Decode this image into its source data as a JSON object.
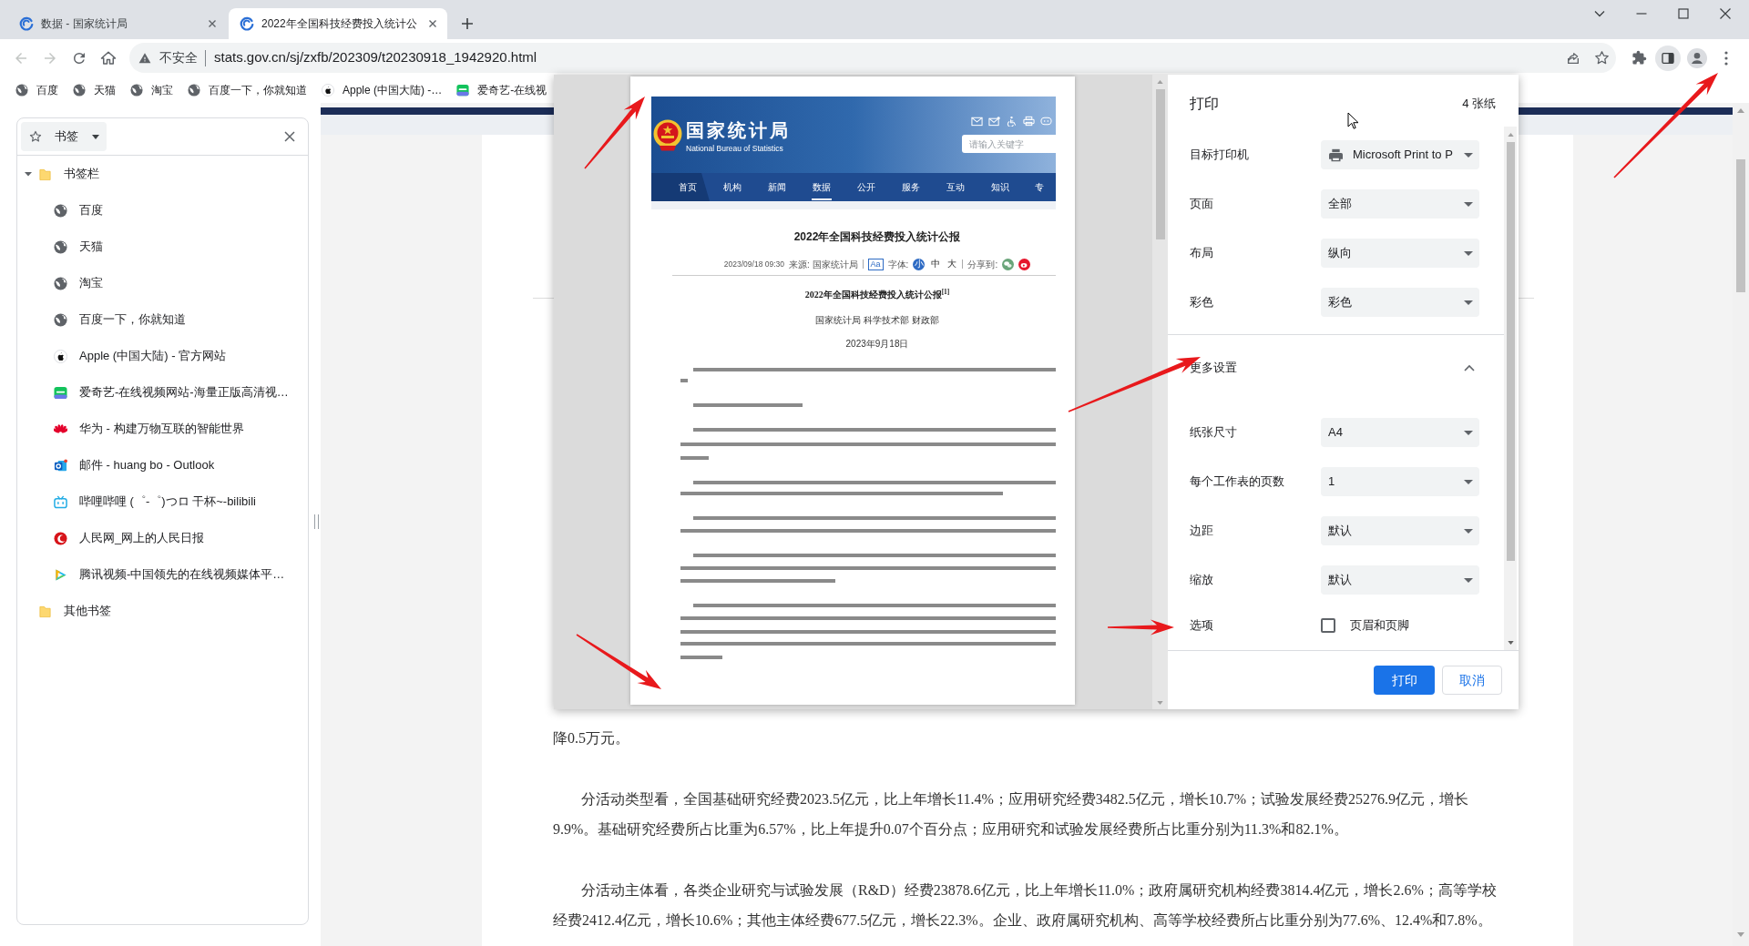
{
  "tabs": [
    {
      "title": "数据 - 国家统计局",
      "selected": false
    },
    {
      "title": "2022年全国科技经费投入统计公",
      "selected": true
    }
  ],
  "navigation_buttons": [
    {
      "kind": "back",
      "disabled": true
    },
    {
      "kind": "forward",
      "disabled": true
    },
    {
      "kind": "reload",
      "disabled": false
    },
    {
      "kind": "home",
      "disabled": false
    }
  ],
  "address_bar": {
    "security_label": "不安全",
    "url": "stats.gov.cn/sj/zxfb/202309/t20230918_1942920.html"
  },
  "bookmarks_bar": [
    {
      "label": "百度",
      "kind": "globe"
    },
    {
      "label": "天猫",
      "kind": "globe"
    },
    {
      "label": "淘宝",
      "kind": "globe"
    },
    {
      "label": "百度一下，你就知道",
      "kind": "globe"
    },
    {
      "label": "Apple (中国大陆) -…",
      "kind": "apple"
    },
    {
      "label": "爱奇艺-在线视",
      "kind": "iqiyi"
    }
  ],
  "side_panel": {
    "open": true,
    "title": "书签",
    "tree": [
      {
        "label": "书签栏",
        "kind": "folder",
        "expanded": true,
        "children": [
          {
            "label": "百度",
            "kind": "globe"
          },
          {
            "label": "天猫",
            "kind": "globe"
          },
          {
            "label": "淘宝",
            "kind": "globe"
          },
          {
            "label": "百度一下，你就知道",
            "kind": "globe"
          },
          {
            "label": "Apple (中国大陆) - 官方网站",
            "kind": "apple"
          },
          {
            "label": "爱奇艺-在线视频网站-海量正版高清视…",
            "kind": "iqiyi"
          },
          {
            "label": "华为 - 构建万物互联的智能世界",
            "kind": "huawei"
          },
          {
            "label": "邮件 - huang bo - Outlook",
            "kind": "outlook"
          },
          {
            "label": "哔哩哔哩 (゜-゜)つロ 干杯~-bilibili",
            "kind": "bilibili"
          },
          {
            "label": "人民网_网上的人民日报",
            "kind": "renmin"
          },
          {
            "label": "腾讯视频-中国领先的在线视频媒体平…",
            "kind": "tencent"
          }
        ]
      },
      {
        "label": "其他书签",
        "kind": "folder"
      }
    ]
  },
  "print_dialog": {
    "title": "打印",
    "sheet_count": "4 张纸",
    "preview": {
      "site_title": "国家统计局",
      "site_subtitle": "National Bureau of Statistics",
      "search_placeholder": "请输入关键字",
      "nav": [
        {
          "label": "首页",
          "kind": "home",
          "selected": false
        },
        {
          "label": "机构",
          "kind": "link",
          "selected": false
        },
        {
          "label": "新闻",
          "kind": "link",
          "selected": false
        },
        {
          "label": "数据",
          "kind": "link",
          "selected": true
        },
        {
          "label": "公开",
          "kind": "link",
          "selected": false
        },
        {
          "label": "服务",
          "kind": "link",
          "selected": false
        },
        {
          "label": "互动",
          "kind": "link",
          "selected": false
        },
        {
          "label": "知识",
          "kind": "link",
          "selected": false
        },
        {
          "label": "专",
          "kind": "link",
          "selected": false
        }
      ],
      "article_title": "2022年全国科技经费投入统计公报",
      "meta": {
        "datetime": "2023/09/18 09:30",
        "source": "来源: 国家统计局",
        "font_button": "Aa",
        "font_label": "字体:",
        "font_sizes": [
          {
            "label": "小",
            "selected": true
          },
          {
            "label": "中",
            "selected": false
          },
          {
            "label": "大",
            "selected": false
          }
        ],
        "share_label": "分享到:"
      },
      "document_title": "2022年全国科技经费投入统计公报$^{[1]}$",
      "document_authors": "国家统计局 科学技术部 财政部",
      "document_date": "2023年9月18日"
    },
    "settings": [
      {
        "label": "目标打印机",
        "kind": "printer",
        "value": "Microsoft Print to P"
      },
      {
        "label": "页面",
        "kind": "dropdown",
        "value": "全部"
      },
      {
        "label": "布局",
        "kind": "dropdown",
        "value": "纵向"
      },
      {
        "label": "彩色",
        "kind": "dropdown",
        "value": "彩色"
      }
    ],
    "more_settings": {
      "label": "更多设置",
      "expanded": true
    },
    "more_settings_items": [
      {
        "label": "纸张尺寸",
        "kind": "dropdown",
        "value": "A4"
      },
      {
        "label": "每个工作表的页数",
        "kind": "dropdown",
        "value": "1"
      },
      {
        "label": "边距",
        "kind": "dropdown",
        "value": "默认"
      },
      {
        "label": "缩放",
        "kind": "dropdown",
        "value": "默认"
      },
      {
        "label": "选项",
        "kind": "checkbox",
        "option": "页眉和页脚",
        "checked": false
      }
    ],
    "buttons": [
      {
        "label": "打印",
        "kind": "primary"
      },
      {
        "label": "取消",
        "kind": "secondary"
      }
    ]
  },
  "page_text": [
    {
      "kind": "continuation",
      "text": "降0.5万元。"
    },
    {
      "kind": "paragraph",
      "text": "分活动类型看，全国基础研究经费2023.5亿元，比上年增长11.4%；应用研究经费3482.5亿元，增长10.7%；试验发展经费25276.9亿元，增长9.9%。基础研究经费所占比重为6.57%，比上年提升0.07个百分点；应用研究和试验发展经费所占比重分别为11.3%和82.1%。"
    },
    {
      "kind": "paragraph",
      "text": "分活动主体看，各类企业研究与试验发展（R&D）经费23878.6亿元，比上年增长11.0%；政府属研究机构经费3814.4亿元，增长2.6%；高等学校经费2412.4亿元，增长10.6%；其他主体经费677.5亿元，增长22.3%。企业、政府属研究机构、高等学校经费所占比重分别为77.6%、12.4%和7.8%。"
    }
  ]
}
